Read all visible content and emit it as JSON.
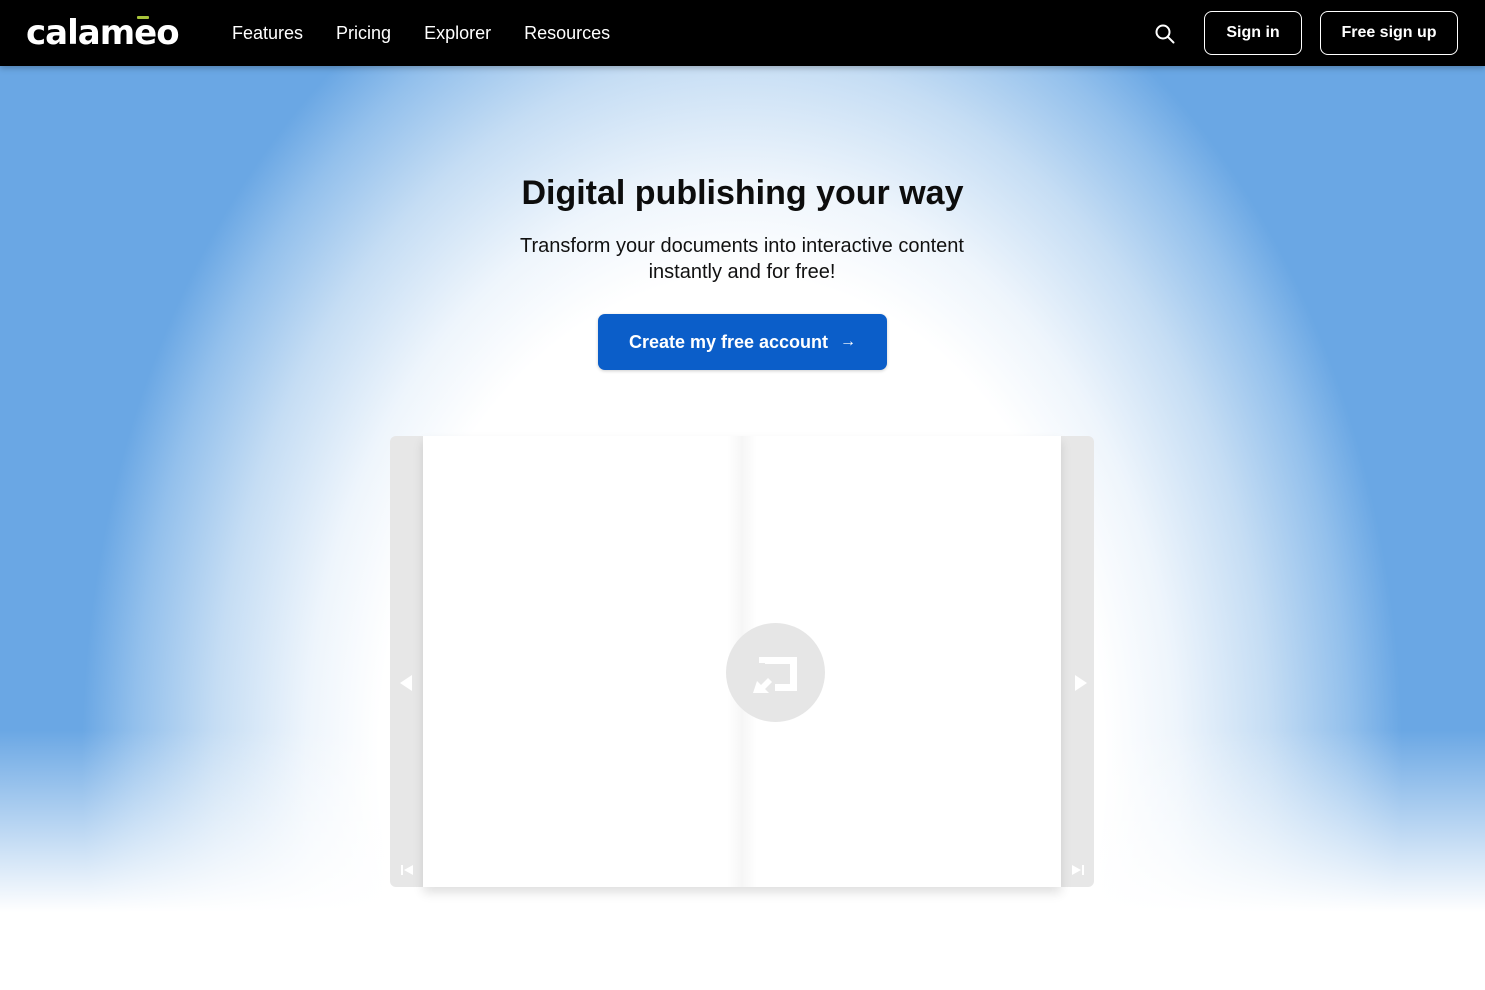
{
  "header": {
    "logo_text": "calameo",
    "nav": [
      {
        "label": "Features"
      },
      {
        "label": "Pricing"
      },
      {
        "label": "Explorer"
      },
      {
        "label": "Resources"
      }
    ],
    "search_icon": "search-icon",
    "sign_in_label": "Sign in",
    "sign_up_label": "Free sign up"
  },
  "hero": {
    "title": "Digital publishing your way",
    "subtitle": "Transform your documents into interactive content instantly and for free!",
    "cta_label": "Create my free account",
    "cta_arrow": "→"
  },
  "viewer": {
    "icons": {
      "prev": "triangle-left-icon",
      "next": "triangle-right-icon",
      "first": "skip-first-icon",
      "last": "skip-last-icon",
      "loading": "calameo-loading-icon"
    }
  },
  "colors": {
    "header_bg": "#000000",
    "accent_green": "#a8c43a",
    "cta_blue": "#0b5ec9",
    "sky_blue": "#6aa7e4"
  }
}
